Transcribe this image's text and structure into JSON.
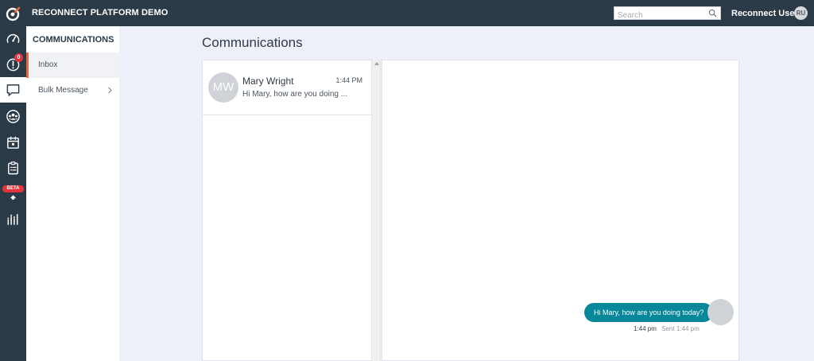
{
  "app": {
    "title": "RECONNECT PLATFORM DEMO"
  },
  "header": {
    "search_placeholder": "Search",
    "user_name": "Reconnect User",
    "user_initials": "RU"
  },
  "rail": {
    "items": [
      {
        "icon": "speedometer-icon"
      },
      {
        "icon": "alert-icon",
        "badge": "0"
      },
      {
        "icon": "chat-bubble-icon",
        "active": true
      },
      {
        "icon": "group-icon"
      },
      {
        "icon": "calendar-icon"
      },
      {
        "icon": "clipboard-icon"
      },
      {
        "icon": "beta-feature-icon",
        "badge": "BETA"
      },
      {
        "icon": "bar-chart-icon"
      }
    ]
  },
  "nav": {
    "title": "COMMUNICATIONS",
    "items": [
      {
        "label": "Inbox",
        "active": true
      },
      {
        "label": "Bulk Message"
      }
    ]
  },
  "main": {
    "title": "Communications"
  },
  "conversations": [
    {
      "initials": "MW",
      "name": "Mary Wright",
      "time": "1:44 PM",
      "preview": "Hi Mary, how are you doing ..."
    }
  ],
  "chat": {
    "messages": [
      {
        "text": "Hi Mary, how are you doing today?",
        "time": "1:44 pm",
        "status": "Sent 1:44 pm"
      }
    ]
  },
  "colors": {
    "topbar": "#2b3a47",
    "accent": "#e8693a",
    "bubble": "#06879a",
    "badge": "#e5333d"
  }
}
